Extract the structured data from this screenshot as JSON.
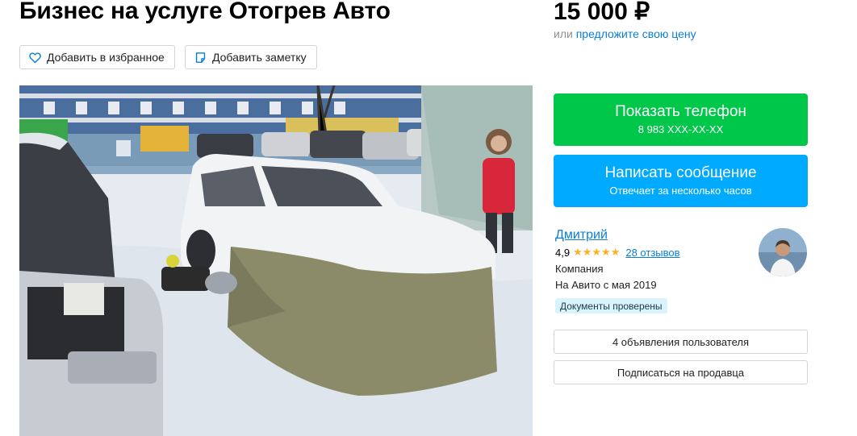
{
  "listing": {
    "title": "Бизнес на услуге Отогрев Авто",
    "price": "15 000 ₽",
    "price_alt_prefix": "или",
    "price_alt_link": "предложите свою цену"
  },
  "actions": {
    "favorite_label": "Добавить в избранное",
    "note_label": "Добавить заметку"
  },
  "contact": {
    "show_phone_label": "Показать телефон",
    "phone_masked": "8 983 XXX-XX-XX",
    "message_label": "Написать сообщение",
    "message_sub": "Отвечает за несколько часов"
  },
  "seller": {
    "name": "Дмитрий",
    "rating": "4,9",
    "stars": "★★★★★",
    "reviews": "28 отзывов",
    "type": "Компания",
    "since": "На Авито с мая 2019",
    "badge": "Документы проверены",
    "listings_button": "4 объявления пользователя",
    "subscribe_button": "Подписаться на продавца"
  },
  "icons": {
    "favorite": "heart-icon",
    "note": "note-icon"
  },
  "colors": {
    "green_button": "#00c74a",
    "blue_button": "#00aaff",
    "link": "#0a7ed6",
    "star": "#ffb021",
    "badge_bg": "#d9f2fc"
  }
}
